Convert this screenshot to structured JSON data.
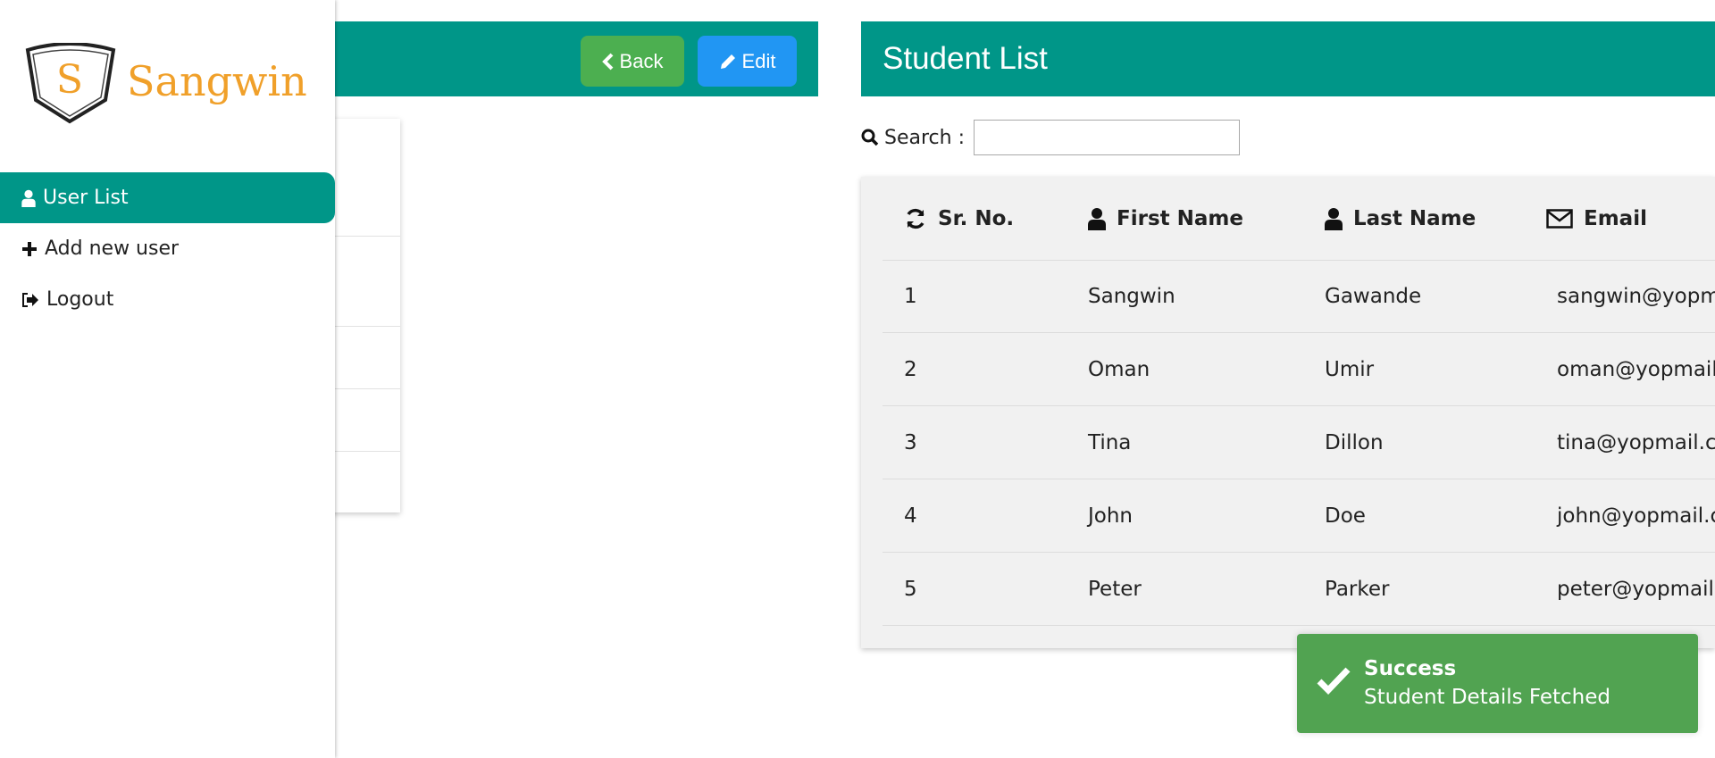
{
  "colors": {
    "primary": "#009688",
    "back": "#4caf50",
    "edit": "#2196f3",
    "toast": "#51a351",
    "brand": "#f0a02a"
  },
  "sidebar": {
    "logo_letter": "S",
    "brand_name": "Sangwin",
    "items": [
      {
        "label": "User List",
        "icon": "user-icon",
        "active": true
      },
      {
        "label": "Add new user",
        "icon": "plus-icon",
        "active": false
      },
      {
        "label": "Logout",
        "icon": "sign-out-icon",
        "active": false
      }
    ]
  },
  "detail": {
    "back_label": "Back",
    "edit_label": "Edit"
  },
  "student_list": {
    "title": "Student List",
    "search_label": "Search :",
    "search_value": "",
    "columns": [
      "Sr. No.",
      "First Name",
      "Last Name",
      "Email"
    ],
    "rows": [
      [
        "1",
        "Sangwin",
        "Gawande",
        "sangwin@yopm"
      ],
      [
        "2",
        "Oman",
        "Umir",
        "oman@yopmail"
      ],
      [
        "3",
        "Tina",
        "Dillon",
        "tina@yopmail.c"
      ],
      [
        "4",
        "John",
        "Doe",
        "john@yopmail.c"
      ],
      [
        "5",
        "Peter",
        "Parker",
        "peter@yopmail."
      ]
    ]
  },
  "toast": {
    "title": "Success",
    "message": "Student Details Fetched"
  }
}
